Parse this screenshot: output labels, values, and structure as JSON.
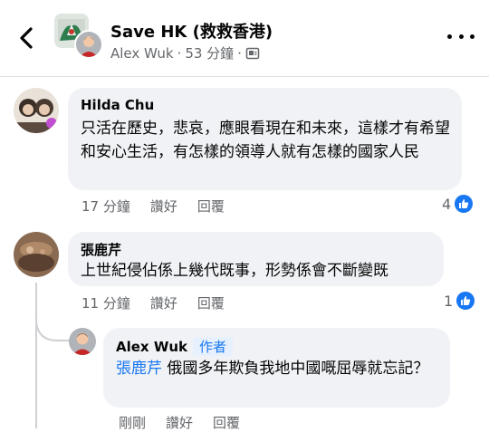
{
  "header": {
    "page_name": "Save HK (救救香港)",
    "author": "Alex Wuk",
    "separator": "·",
    "time": "53 分鐘"
  },
  "comments": [
    {
      "author": "Hilda Chu",
      "text": "只活在歷史，悲哀，應眼看現在和未來，這樣才有希望和安心生活，有怎樣的領導人就有怎樣的國家人民",
      "time": "17 分鐘",
      "like_label": "讚好",
      "reply_label": "回覆",
      "reactions": "4"
    },
    {
      "author": "張鹿芹",
      "text": "上世紀侵佔係上幾代既事，形勢係會不斷變既",
      "time": "11 分鐘",
      "like_label": "讚好",
      "reply_label": "回覆",
      "reactions": "1"
    }
  ],
  "reply": {
    "author": "Alex Wuk",
    "author_tag": "作者",
    "mention": "張鹿芹",
    "text": " 俄國多年欺負我地中國嘅屈辱就忘記？",
    "time": "剛剛",
    "like_label": "讚好",
    "reply_label": "回覆"
  },
  "colors": {
    "accent": "#1877f2",
    "bubble": "#f0f2f5",
    "meta": "#65676b"
  }
}
